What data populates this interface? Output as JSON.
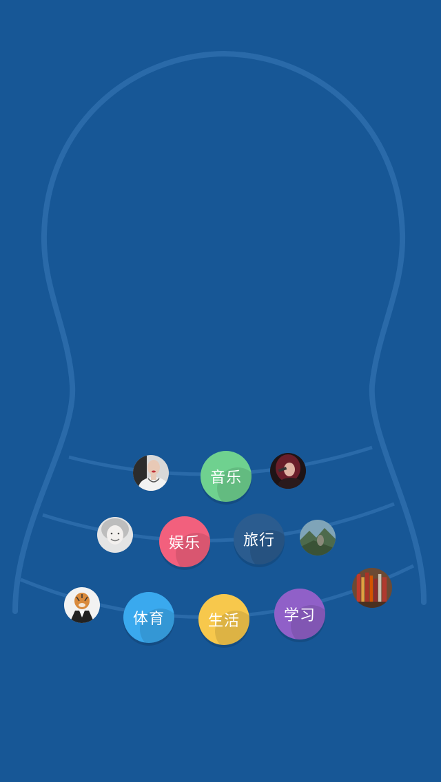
{
  "screen": {
    "background_color": "#175796",
    "outline_color": "#2a6aa9"
  },
  "categories": [
    {
      "id": "music",
      "label": "音乐",
      "color": "#6fd18f"
    },
    {
      "id": "entertainment",
      "label": "娱乐",
      "color": "#f2607d"
    },
    {
      "id": "travel",
      "label": "旅行",
      "color": "#2b5c8f"
    },
    {
      "id": "sports",
      "label": "体育",
      "color": "#3aa9ee"
    },
    {
      "id": "life",
      "label": "生活",
      "color": "#f7c84c"
    },
    {
      "id": "study",
      "label": "学习",
      "color": "#9060c8"
    }
  ],
  "avatars": [
    {
      "icon": "woman-necklace-avatar"
    },
    {
      "icon": "singer-microphone-avatar"
    },
    {
      "icon": "smiling-woman-avatar"
    },
    {
      "icon": "mountain-landscape-avatar"
    },
    {
      "icon": "tiger-in-suit-avatar"
    },
    {
      "icon": "bookshelf-avatar"
    }
  ]
}
